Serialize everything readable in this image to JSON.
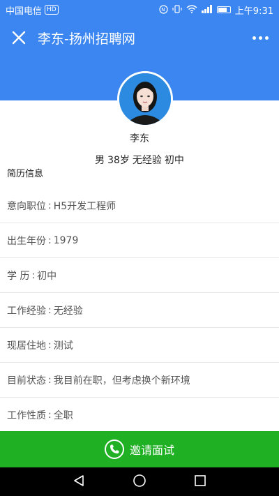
{
  "status_bar": {
    "carrier": "中国电信",
    "carrier_badge": "HD",
    "time": "上午9:31"
  },
  "header": {
    "title": "李东-扬州招聘网"
  },
  "profile": {
    "name": "李东",
    "gender": "男",
    "age": "38岁",
    "experience": "无经验",
    "education": "初中"
  },
  "section_title": "简历信息",
  "info_rows": [
    {
      "label": "意向职位",
      "value": "H5开发工程师"
    },
    {
      "label": "出生年份",
      "value": "1979"
    },
    {
      "label": "学 历",
      "value": "初中"
    },
    {
      "label": "工作经验",
      "value": "无经验"
    },
    {
      "label": "现居住地",
      "value": "测试"
    },
    {
      "label": "目前状态",
      "value": "我目前在职，但考虑换个新环境"
    },
    {
      "label": "工作性质",
      "value": "全职"
    }
  ],
  "invite": {
    "label": "邀请面试"
  },
  "colors": {
    "primary_blue": "#3b86f0",
    "invite_green": "#1fb024"
  },
  "icons": [
    "close-icon",
    "more-icon",
    "phone-icon",
    "back-icon",
    "home-icon",
    "recents-icon"
  ]
}
